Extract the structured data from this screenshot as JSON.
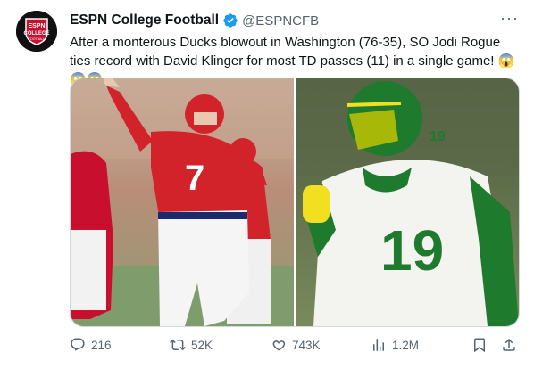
{
  "tweet": {
    "author_name": "ESPN College Football",
    "author_handle": "@ESPNCFB",
    "text": "After a monterous Ducks blowout in Washington (76-35), SO Jodi Rogue ties record with David Klinger for most TD passes (11) in a single game! 😱😱😱",
    "more_label": "···"
  },
  "avatar": {
    "logo_text": "ESPN",
    "subtitle": "COLLEGE",
    "subtitle2": "FOOTBALL"
  },
  "media": {
    "left_jersey_number": "7",
    "right_jersey_number": "19",
    "right_jersey_color": "#1e7a2c",
    "left_jersey_color": "#d2232a"
  },
  "actions": {
    "replies": "216",
    "retweets": "52K",
    "likes": "743K",
    "views": "1.2M"
  },
  "colors": {
    "verified": "#1d9bf0",
    "muted": "#536471"
  }
}
